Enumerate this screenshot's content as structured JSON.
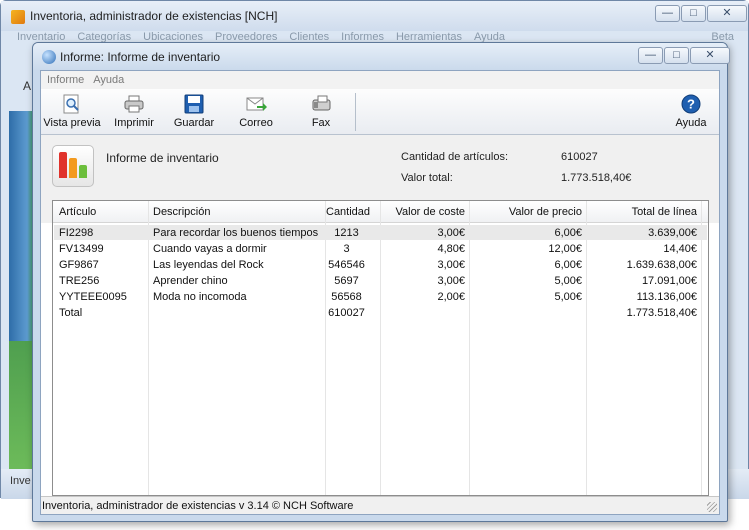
{
  "back_window": {
    "title": "Inventoria, administrador de existencias [NCH]",
    "menu": [
      "Inventario",
      "Categorías",
      "Ubicaciones",
      "Proveedores",
      "Clientes",
      "Informes",
      "Herramientas",
      "Ayuda"
    ],
    "beta": "Beta",
    "partial_left_label": "A",
    "partial_bottom_label": "Inve"
  },
  "front_window": {
    "title": "Informe: Informe de inventario",
    "menu": [
      "Informe",
      "Ayuda"
    ],
    "toolbar": {
      "preview": "Vista previa",
      "print": "Imprimir",
      "save": "Guardar",
      "email": "Correo",
      "fax": "Fax",
      "help": "Ayuda"
    },
    "summary": {
      "report_title": "Informe de inventario",
      "items_label": "Cantidad de artículos:",
      "items_value": "610027",
      "total_label": "Valor total:",
      "total_value": "1.773.518,40€"
    },
    "table": {
      "headers": [
        "Artículo",
        "Descripción",
        "Cantidad",
        "Valor de coste",
        "Valor de precio",
        "Total de línea"
      ],
      "rows": [
        [
          "FI2298",
          "Para recordar los buenos tiempos",
          "1213",
          "3,00€",
          "6,00€",
          "3.639,00€"
        ],
        [
          "FV13499",
          "Cuando vayas a dormir",
          "3",
          "4,80€",
          "12,00€",
          "14,40€"
        ],
        [
          "GF9867",
          "Las leyendas del Rock",
          "546546",
          "3,00€",
          "6,00€",
          "1.639.638,00€"
        ],
        [
          "TRE256",
          "Aprender chino",
          "5697",
          "3,00€",
          "5,00€",
          "17.091,00€"
        ],
        [
          "YYTEEE0095",
          "Moda no incomoda",
          "56568",
          "2,00€",
          "5,00€",
          "113.136,00€"
        ]
      ],
      "total_row": [
        "Total",
        "",
        "610027",
        "",
        "",
        "1.773.518,40€"
      ]
    },
    "status": "Inventoria, administrador de existencias v 3.14 © NCH Software"
  },
  "colors": {
    "chrome_blue": "#c9d9ec",
    "selected_row": "#e9e9e9",
    "report_bar_red": "#e0322b",
    "report_bar_orange": "#f39a1e",
    "report_bar_green": "#6cbf3c"
  }
}
